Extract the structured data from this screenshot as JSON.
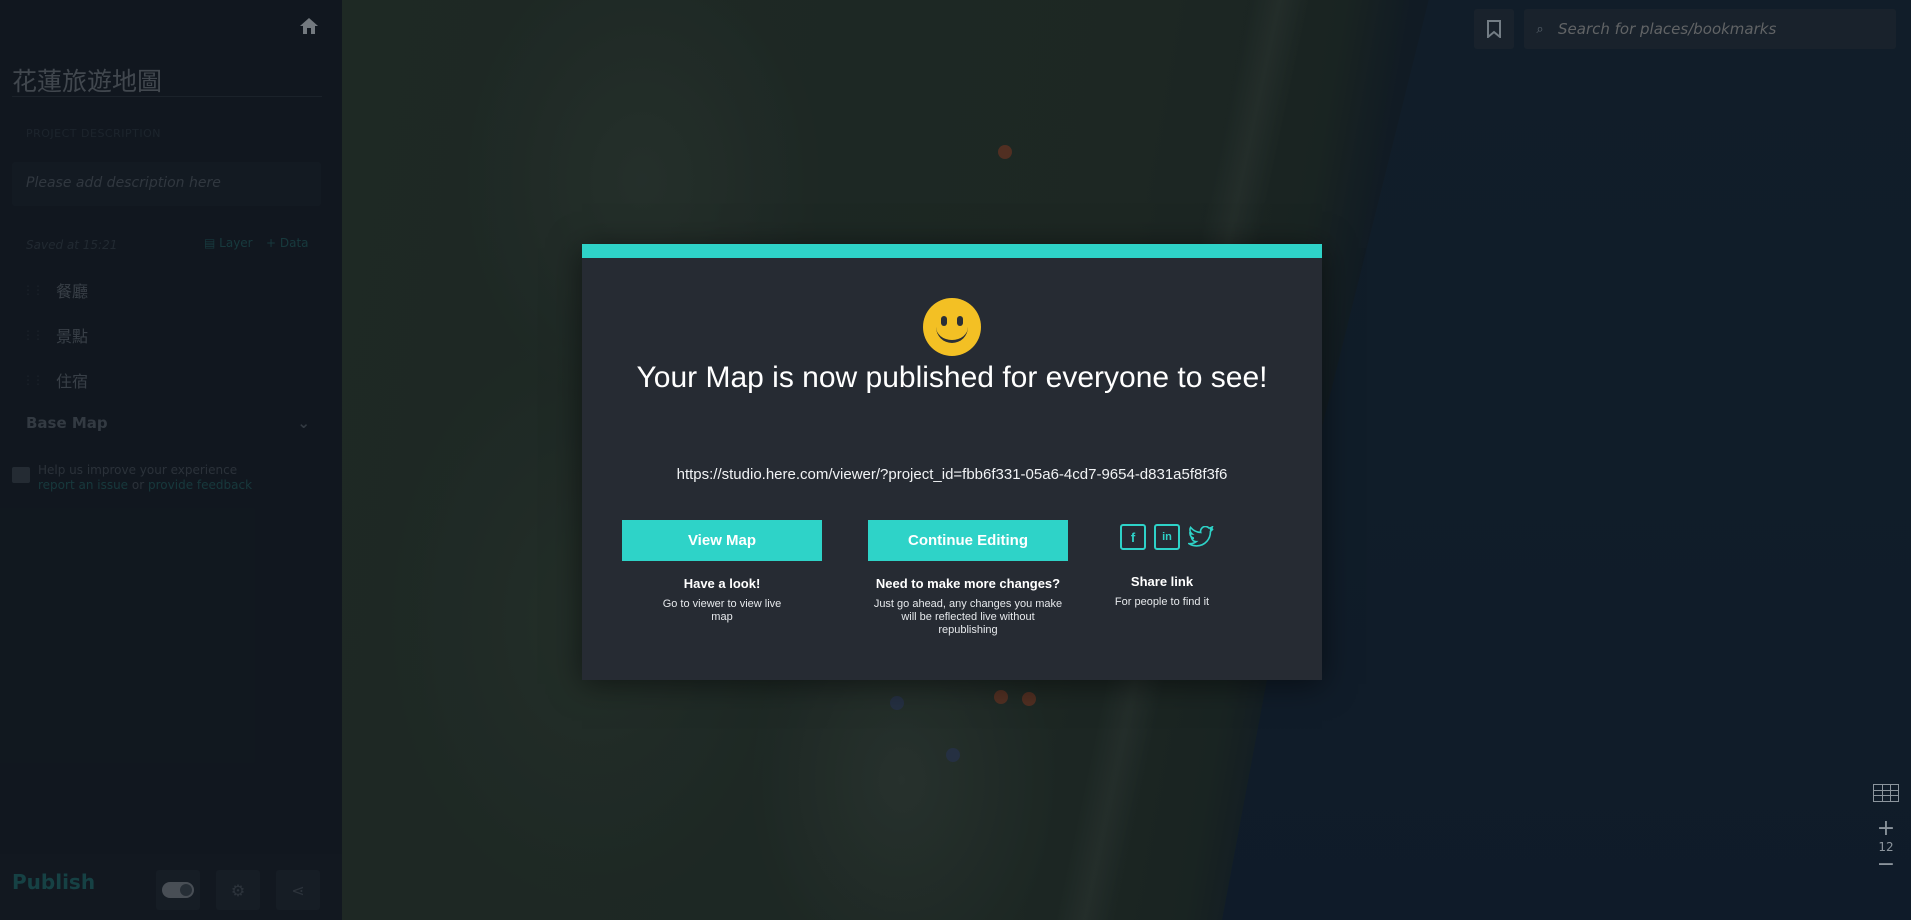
{
  "sidebar": {
    "project_title": "花蓮旅遊地圖",
    "description_label": "PROJECT DESCRIPTION",
    "description_placeholder": "Please add description here",
    "saved_text": "Saved at 15:21",
    "add_layer_label": "Layer",
    "add_data_label": "+ Data",
    "layers": [
      "餐廳",
      "景點",
      "住宿"
    ],
    "base_map_label": "Base Map",
    "help_text": "Help us improve your experience",
    "report_issue_link": "report an issue",
    "or_text": "or",
    "feedback_link": "provide feedback",
    "publish_label": "Publish"
  },
  "map": {
    "search_placeholder": "Search for places/bookmarks",
    "zoom_level": "12",
    "zoom_in": "+",
    "zoom_out": "−"
  },
  "modal": {
    "title": "Your Map is now published for everyone to see!",
    "url": "https://studio.here.com/viewer/?project_id=fbb6f331-05a6-4cd7-9654-d831a5f8f3f6",
    "view_map_label": "View Map",
    "view_map_heading": "Have a look!",
    "view_map_sub": "Go to viewer to view live map",
    "continue_label": "Continue Editing",
    "continue_heading": "Need to make more changes?",
    "continue_sub": "Just go ahead, any changes you make will be reflected live without republishing",
    "share_heading": "Share link",
    "share_sub": "For people to find it",
    "accent_color": "#2ed3c8"
  },
  "icons": {
    "smiley": "smiley-face-icon",
    "home": "home-icon",
    "bookmark": "bookmark-icon",
    "search": "search-icon",
    "facebook": "facebook-icon",
    "linkedin": "linkedin-icon",
    "twitter": "twitter-icon"
  }
}
